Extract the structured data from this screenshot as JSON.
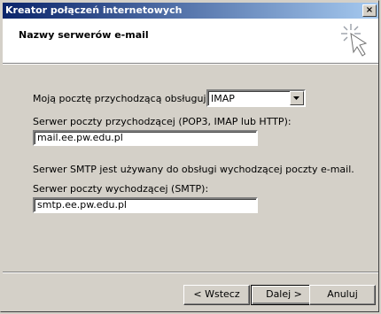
{
  "window": {
    "title": "Kreator połączeń internetowych",
    "close_glyph": "×"
  },
  "header": {
    "title": "Nazwy serwerów e-mail",
    "icon": "wizard-wand-icon"
  },
  "form": {
    "incoming_type_label": "Moją pocztę przychodzącą obsługuje serwer:",
    "incoming_type_value": "IMAP",
    "incoming_server_label": "Serwer poczty przychodzącej (POP3, IMAP lub HTTP):",
    "incoming_server_value": "mail.ee.pw.edu.pl",
    "smtp_note": "Serwer SMTP jest używany do obsługi wychodzącej poczty e-mail.",
    "outgoing_server_label": "Serwer poczty wychodzącej (SMTP):",
    "outgoing_server_value": "smtp.ee.pw.edu.pl"
  },
  "buttons": {
    "back": "< Wstecz",
    "next": "Dalej >",
    "cancel": "Anuluj"
  },
  "colors": {
    "titlebar_start": "#0a246a",
    "titlebar_end": "#a6caf0",
    "face": "#d4d0c8"
  }
}
